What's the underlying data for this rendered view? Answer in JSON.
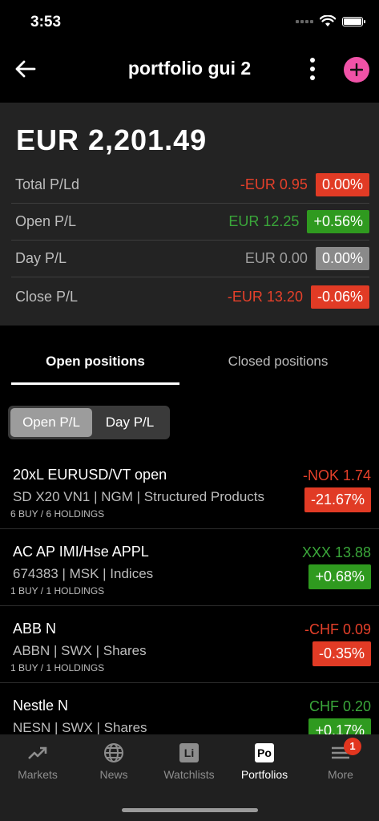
{
  "status": {
    "time": "3:53"
  },
  "header": {
    "title": "portfolio gui 2"
  },
  "summary": {
    "total": "EUR 2,201.49",
    "rows": [
      {
        "label": "Total P/Ld",
        "value": "-EUR 0.95",
        "pct": "0.00%"
      },
      {
        "label": "Open P/L",
        "value": "EUR 12.25",
        "pct": "+0.56%"
      },
      {
        "label": "Day P/L",
        "value": "EUR 0.00",
        "pct": "0.00%"
      },
      {
        "label": "Close P/L",
        "value": "-EUR 13.20",
        "pct": "-0.06%"
      }
    ]
  },
  "tabs": {
    "open": "Open positions",
    "closed": "Closed positions"
  },
  "segment": {
    "open_pl": "Open P/L",
    "day_pl": "Day P/L"
  },
  "positions": [
    {
      "name": "20xL EURUSD/VT open",
      "sub": "SD X20 VN1   |   NGM   |   Structured Products",
      "holdings": "6 BUY / 6 HOLDINGS",
      "value": "-NOK 1.74",
      "pct": "-21.67%"
    },
    {
      "name": "AC AP IMI/Hse APPL",
      "sub": "674383   |   MSK   |   Indices",
      "holdings": "1 BUY / 1 HOLDINGS",
      "value": "XXX 13.88",
      "pct": "+0.68%"
    },
    {
      "name": "ABB N",
      "sub": "ABBN   |   SWX   |   Shares",
      "holdings": "1 BUY / 1 HOLDINGS",
      "value": "-CHF 0.09",
      "pct": "-0.35%"
    },
    {
      "name": "Nestle N",
      "sub": "NESN   |   SWX   |   Shares",
      "holdings": "",
      "value": "CHF 0.20",
      "pct": "+0.17%"
    }
  ],
  "nav": {
    "markets": "Markets",
    "news": "News",
    "watchlists": "Watchlists",
    "watchlists_icon": "Li",
    "portfolios": "Portfolios",
    "portfolios_icon": "Po",
    "more": "More",
    "more_badge": "1"
  },
  "colors": {
    "accent": "#f052a7",
    "negative": "#e13b25",
    "positive": "#2f9a1f"
  }
}
